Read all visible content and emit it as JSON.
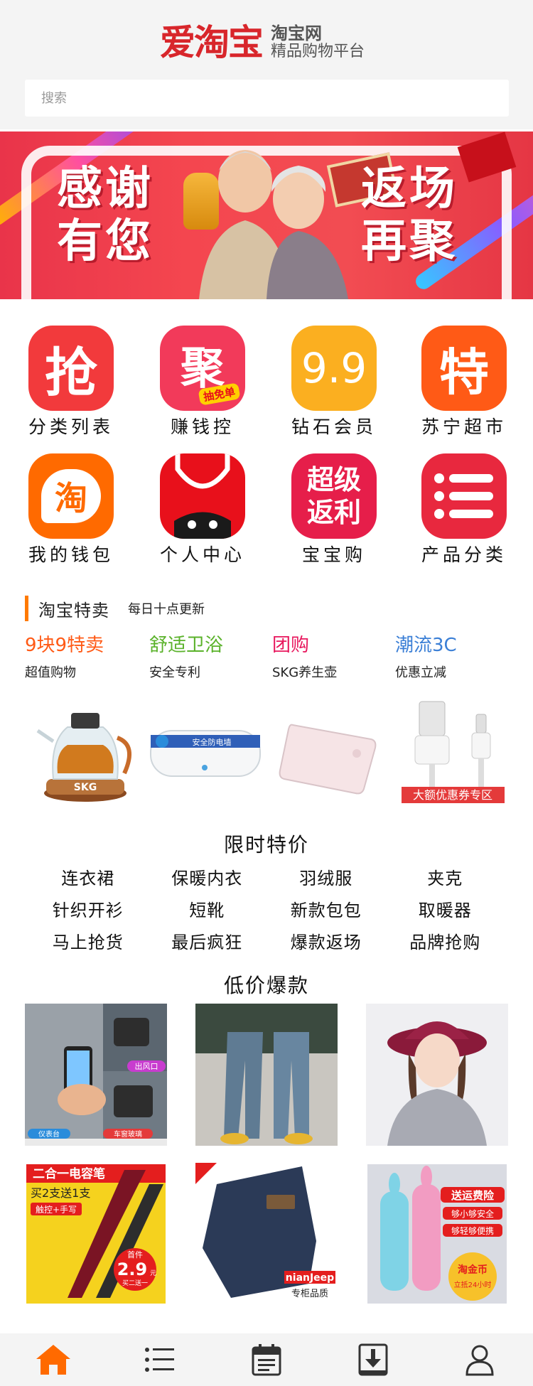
{
  "header": {
    "logo_main": "爱淘宝",
    "logo_side_1": "淘宝网",
    "logo_side_2": "精品购物平台"
  },
  "search": {
    "placeholder": "搜索"
  },
  "banner": {
    "left_line1": "感谢",
    "left_line2": "有您",
    "right_line1": "返场",
    "right_line2": "再聚"
  },
  "grid": [
    {
      "label": "分类列表",
      "icon_text": "抢",
      "icon_badge": "",
      "color": "#f23a3c"
    },
    {
      "label": "赚钱控",
      "icon_text": "聚",
      "icon_badge": "抽免单",
      "color": "#f23a5a"
    },
    {
      "label": "钻石会员",
      "icon_text": "9.9",
      "icon_badge": "",
      "color": "#fbaf20"
    },
    {
      "label": "苏宁超市",
      "icon_text": "特",
      "icon_badge": "",
      "color": "#ff5a16"
    },
    {
      "label": "我的钱包",
      "icon_text": "淘",
      "icon_badge": "",
      "color": "#ff6a00"
    },
    {
      "label": "个人中心",
      "icon_text": "",
      "icon_badge": "",
      "color": "#e8101b"
    },
    {
      "label": "宝宝购",
      "icon_text": "超级返利",
      "icon_badge": "",
      "color": "#e61e4a"
    },
    {
      "label": "产品分类",
      "icon_text": "",
      "icon_badge": "",
      "color": "#e8283e"
    }
  ],
  "special": {
    "title": "淘宝特卖",
    "subtitle": "每日十点更新",
    "deals": [
      {
        "title": "9块9特卖",
        "sub": "超值购物",
        "color": "#ff5a16",
        "img_text": "SKG"
      },
      {
        "title": "舒适卫浴",
        "sub": "安全专利",
        "color": "#5ab22a",
        "img_text": "安全防电墙"
      },
      {
        "title": "团购",
        "sub": "SKG养生壶",
        "color": "#e8175d",
        "img_text": ""
      },
      {
        "title": "潮流3C",
        "sub": "优惠立减",
        "color": "#3b7fd6",
        "img_text": "大额优惠券专区"
      }
    ]
  },
  "limited": {
    "title": "限时特价",
    "rows": [
      [
        "连衣裙",
        "保暖内衣",
        "羽绒服",
        "夹克"
      ],
      [
        "针织开衫",
        "短靴",
        "新款包包",
        "取暖器"
      ],
      [
        "马上抢货",
        "最后疯狂",
        "爆款返场",
        "品牌抢购"
      ]
    ]
  },
  "lowprice": {
    "title": "低价爆款",
    "products": [
      {
        "name": "car-phone-holder",
        "tag_a": "出风口",
        "tag_b": "仪表台",
        "tag_c": "车窗玻璃"
      },
      {
        "name": "mens-jeans-outfit",
        "tag_a": "",
        "tag_b": "",
        "tag_c": ""
      },
      {
        "name": "womens-sweater-hat",
        "tag_a": "",
        "tag_b": "",
        "tag_c": ""
      },
      {
        "name": "stylus-pen",
        "tag_a": "二合一电容笔",
        "tag_b": "买2支送1支",
        "tag_c": "触控+手写",
        "price_label": "首件",
        "price": "2.9",
        "price_unit": "元",
        "price_note": "买二送一"
      },
      {
        "name": "nianjeep-jeans",
        "tag_a": "nianJeep",
        "tag_b": "专柜品质",
        "tag_c": ""
      },
      {
        "name": "cute-power-bank",
        "tag_a": "送运费险",
        "tag_b": "够小够安全",
        "tag_c": "够轻够便携",
        "badge": "淘金币",
        "badge_note": "立抵24小时"
      }
    ]
  },
  "nav": {
    "items": [
      "home-icon",
      "list-icon",
      "calendar-icon",
      "download-icon",
      "user-icon"
    ],
    "active_color": "#ff6a00",
    "inactive_color": "#333333"
  }
}
